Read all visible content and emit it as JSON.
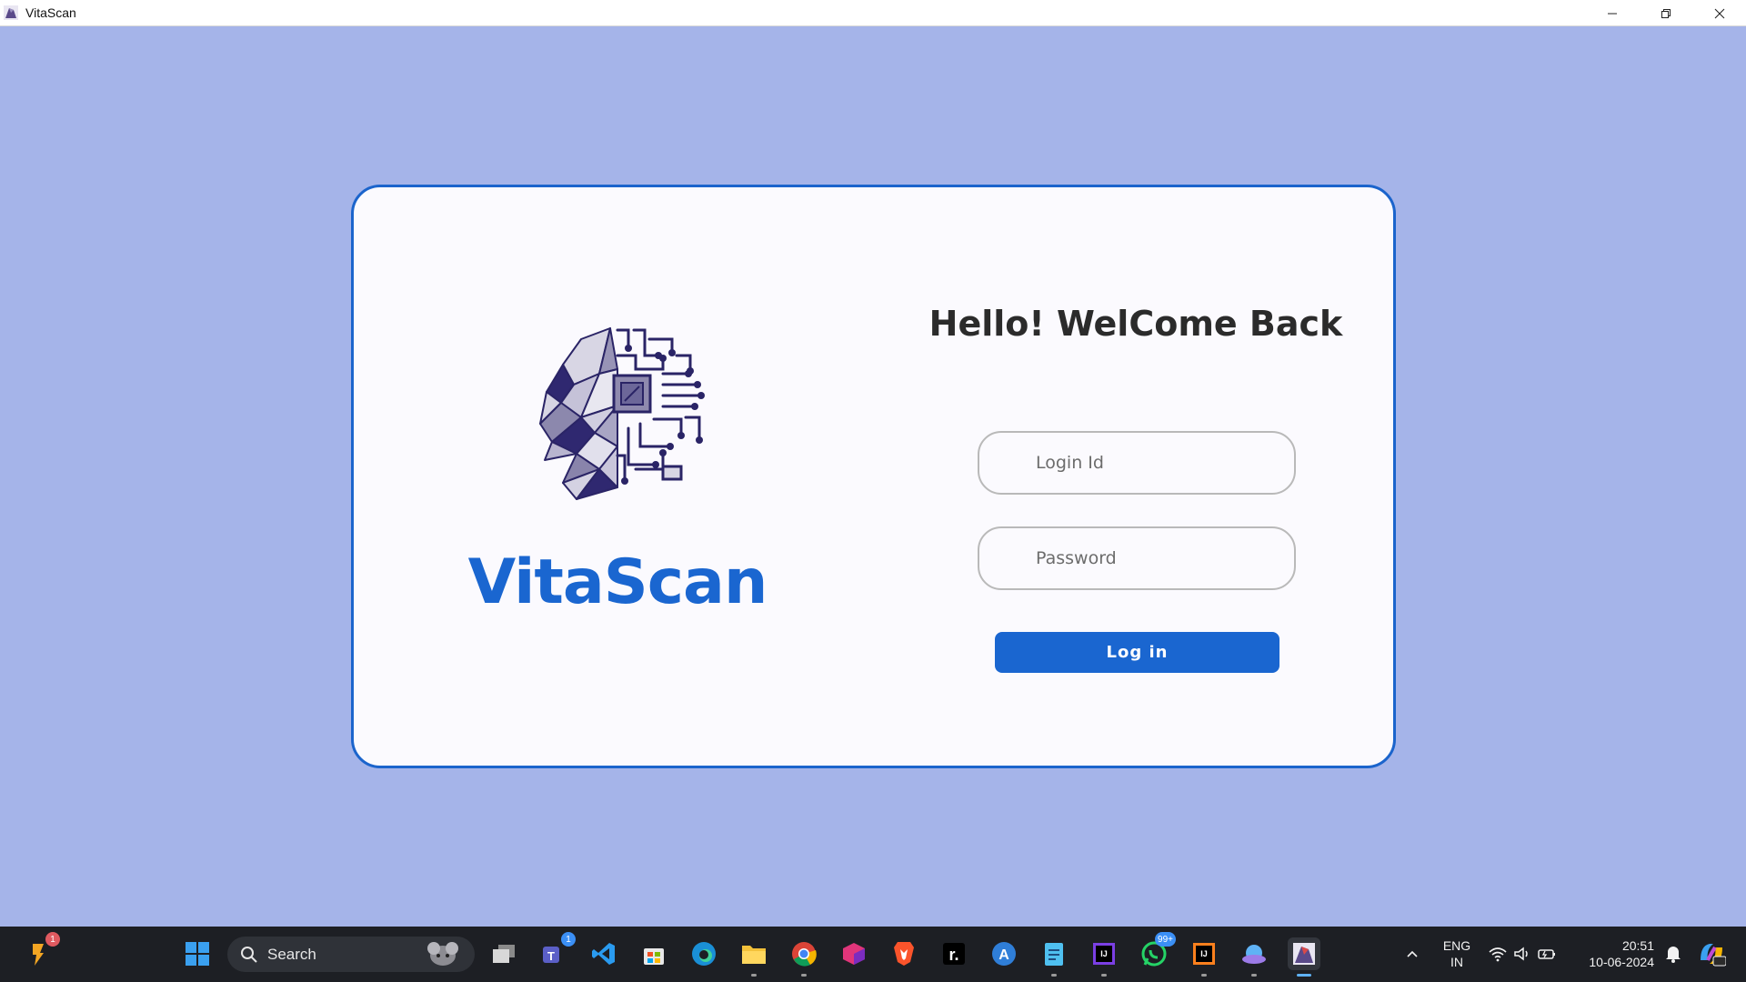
{
  "window": {
    "title": "VitaScan",
    "controls": [
      "minimize-icon",
      "restore-icon",
      "close-icon"
    ]
  },
  "login": {
    "brand_name": "VitaScan",
    "heading": "Hello! WelCome Back",
    "login_id_placeholder": "Login Id",
    "password_placeholder": "Password",
    "login_button": "Log in"
  },
  "colors": {
    "background": "#a5b4e9",
    "accent": "#1a66d0",
    "card": "#fbfafe"
  },
  "taskbar": {
    "search_label": "Search",
    "badges": {
      "left_app": "1",
      "teams": "1",
      "whatsapp": "99+"
    },
    "tray": {
      "language_top": "ENG",
      "language_bottom": "IN",
      "time": "20:51",
      "date": "10-06-2024"
    }
  }
}
